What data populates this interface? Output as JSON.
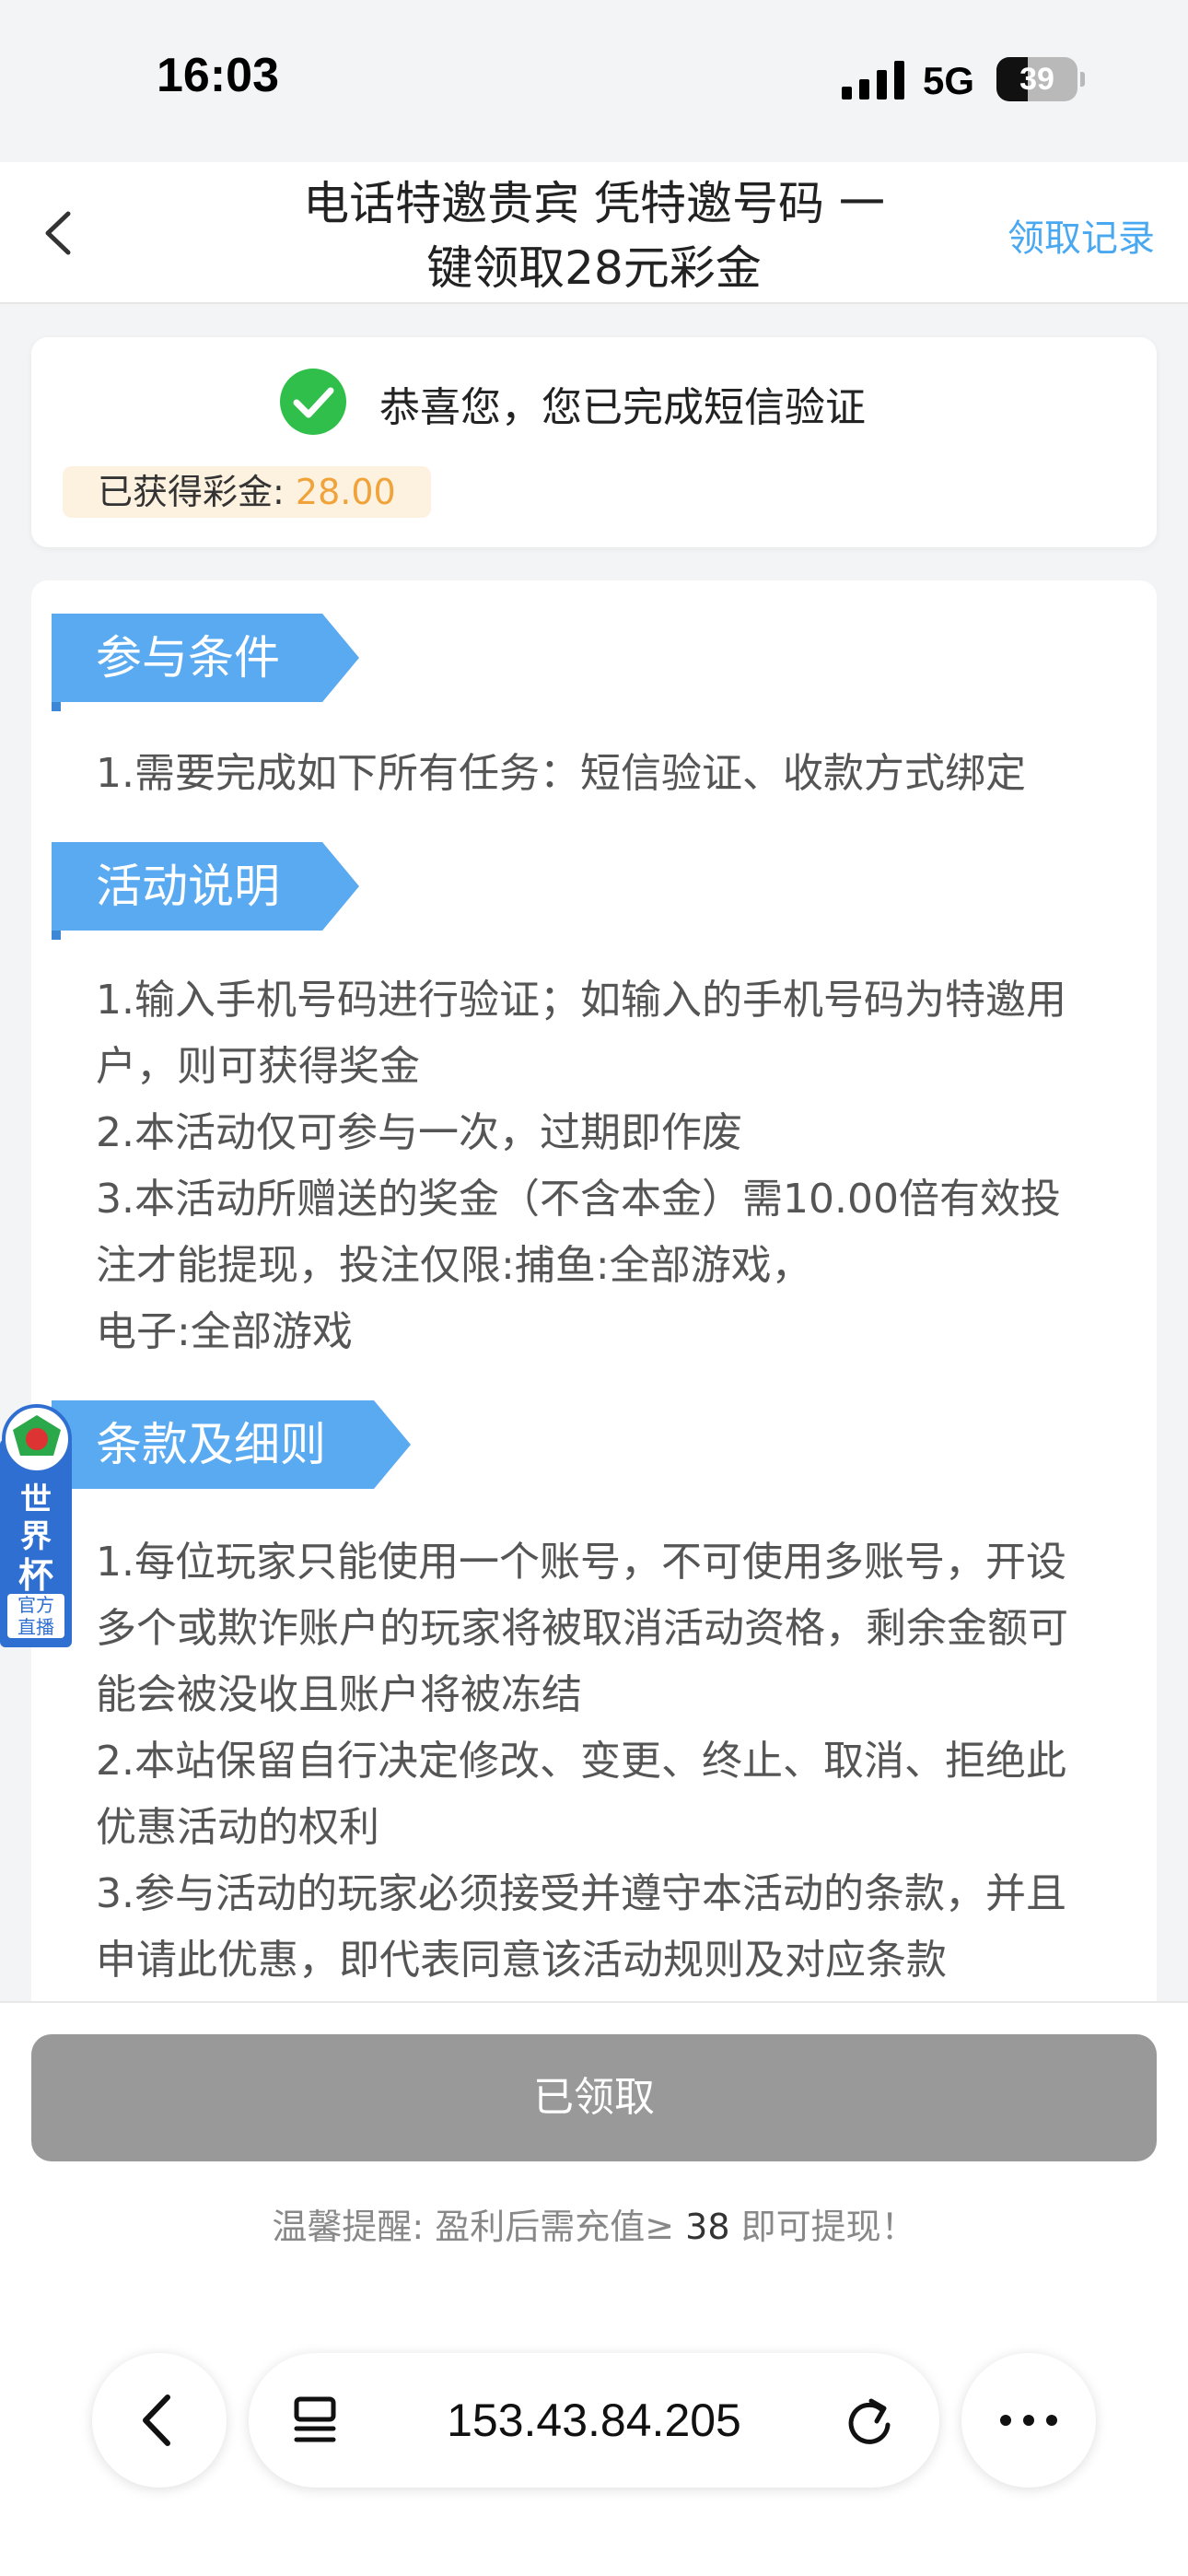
{
  "status_bar": {
    "time": "16:03",
    "network": "5G",
    "battery": "39",
    "battery_level": 0.39
  },
  "header": {
    "title_line1": "电话特邀贵宾 凭特邀号码 一",
    "title_line2": "键领取28元彩金",
    "records_link": "领取记录",
    "back_icon": "chevron-left-icon"
  },
  "success": {
    "message": "恭喜您，您已完成短信验证",
    "bonus_label": "已获得彩金:",
    "bonus_value": "28.00",
    "icon": "check-circle-icon"
  },
  "sections": [
    {
      "title": "参与条件",
      "lines": [
        "1.需要完成如下所有任务：短信验证、收款方式绑定"
      ]
    },
    {
      "title": "活动说明",
      "lines": [
        "1.输入手机号码进行验证；如输入的手机号码为特邀用",
        "户，则可获得奖金",
        "2.本活动仅可参与一次，过期即作废",
        "3.本活动所赠送的奖金（不含本金）需10.00倍有效投",
        "注才能提现，投注仅限:捕鱼:全部游戏，",
        "电子:全部游戏"
      ]
    },
    {
      "title": "条款及细则",
      "lines": [
        "1.每位玩家只能使用一个账号，不可使用多账号，开设",
        "多个或欺诈账户的玩家将被取消活动资格，剩余金额可",
        "能会被没收且账户将被冻结",
        "2.本站保留自行决定修改、变更、终止、取消、拒绝此",
        "优惠活动的权利",
        "3.参与活动的玩家必须接受并遵守本活动的条款，并且",
        "申请此优惠，即代表同意该活动规则及对应条款"
      ]
    }
  ],
  "worldcup_badge": {
    "text1": "世界",
    "text2": "杯",
    "sub1": "官方",
    "sub2": "直播"
  },
  "action": {
    "button_label": "已领取",
    "reminder_prefix": "温馨提醒: 盈利后需充值≥ ",
    "reminder_amount": "38",
    "reminder_suffix": " 即可提现！"
  },
  "browser": {
    "url": "153.43.84.205",
    "back_icon": "chevron-left-icon",
    "reader_icon": "reader-mode-icon",
    "reload_icon": "reload-icon",
    "more_icon": "more-dots-icon"
  },
  "colors": {
    "accent_blue": "#4aa8f0",
    "tag_blue": "#5aaaf2",
    "success_green": "#2fbf4a",
    "bonus_orange": "#f0a33a",
    "button_gray": "#999999"
  }
}
